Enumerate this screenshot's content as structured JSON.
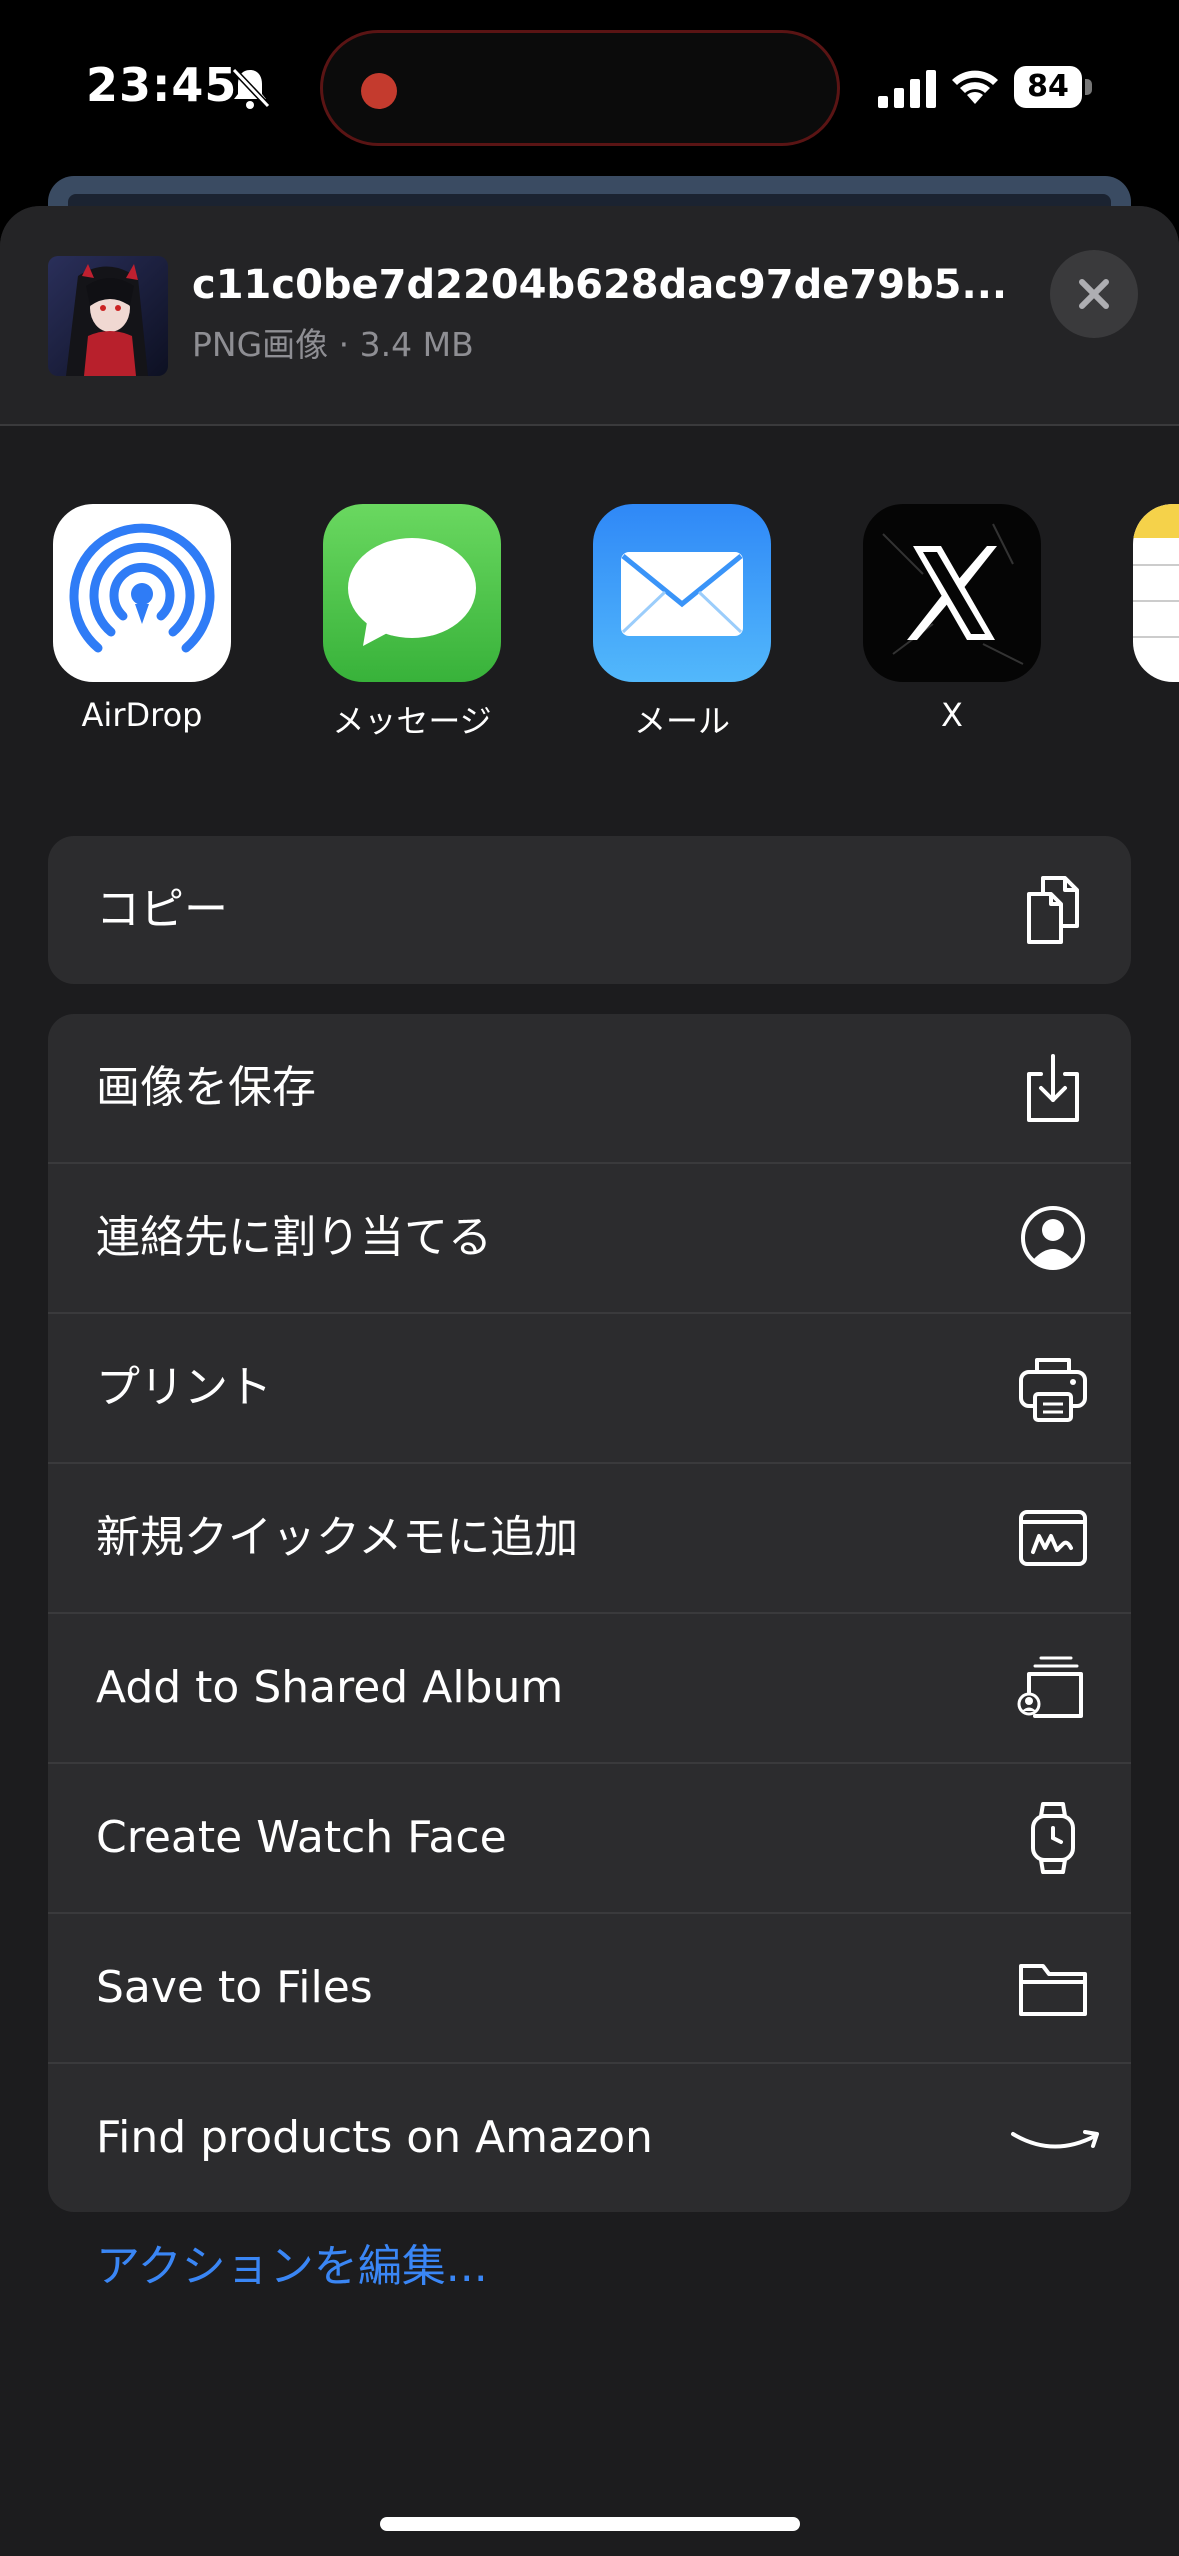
{
  "status_bar": {
    "time": "23:45",
    "battery": "84",
    "icons": [
      "bell-slash-icon",
      "recording-dot-icon",
      "cellular-signal-icon",
      "wifi-icon",
      "battery-icon"
    ]
  },
  "share_header": {
    "file_name": "c11c0be7d2204b628dac97de79b5...",
    "file_meta": "PNG画像 · 3.4 MB",
    "close_icon": "xmark-icon"
  },
  "apps": [
    {
      "label": "AirDrop",
      "icon": "airdrop-icon"
    },
    {
      "label": "メッセージ",
      "icon": "messages-icon"
    },
    {
      "label": "メール",
      "icon": "mail-icon"
    },
    {
      "label": "X",
      "icon": "x-app-icon"
    }
  ],
  "copy_group": [
    {
      "label": "コピー",
      "icon": "copy-icon"
    }
  ],
  "action_group": [
    {
      "label": "画像を保存",
      "icon": "save-image-icon"
    },
    {
      "label": "連絡先に割り当てる",
      "icon": "person-circle-icon"
    },
    {
      "label": "プリント",
      "icon": "printer-icon"
    },
    {
      "label": "新規クイックメモに追加",
      "icon": "quick-note-icon"
    },
    {
      "label": "Add to Shared Album",
      "icon": "shared-album-icon"
    },
    {
      "label": "Create Watch Face",
      "icon": "watch-icon"
    },
    {
      "label": "Save to Files",
      "icon": "folder-icon"
    },
    {
      "label": "Find products on Amazon",
      "icon": "amazon-smile-icon"
    }
  ],
  "edit_actions_label": "アクションを編集...",
  "colors": {
    "sheet_bg": "#1c1c1e",
    "group_bg": "#2c2c2e",
    "separator": "#3a3a3c",
    "link_blue": "#3a86f5",
    "meta_gray": "#8e8e93"
  }
}
